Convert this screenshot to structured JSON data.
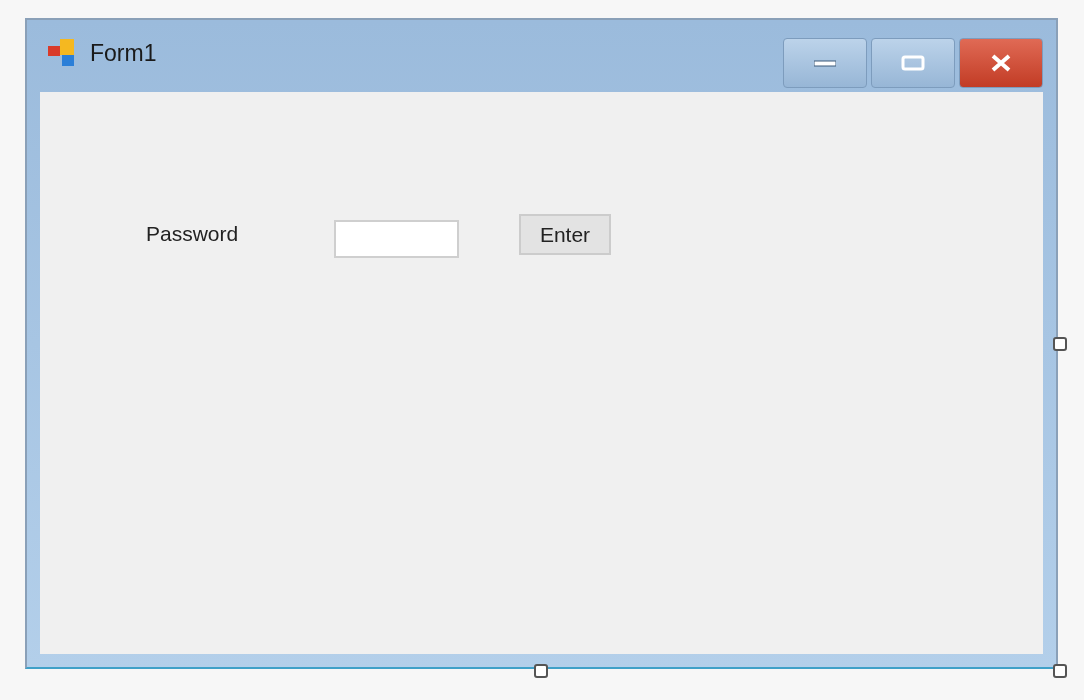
{
  "window": {
    "title": "Form1"
  },
  "form": {
    "label": "Password",
    "button": "Enter"
  }
}
